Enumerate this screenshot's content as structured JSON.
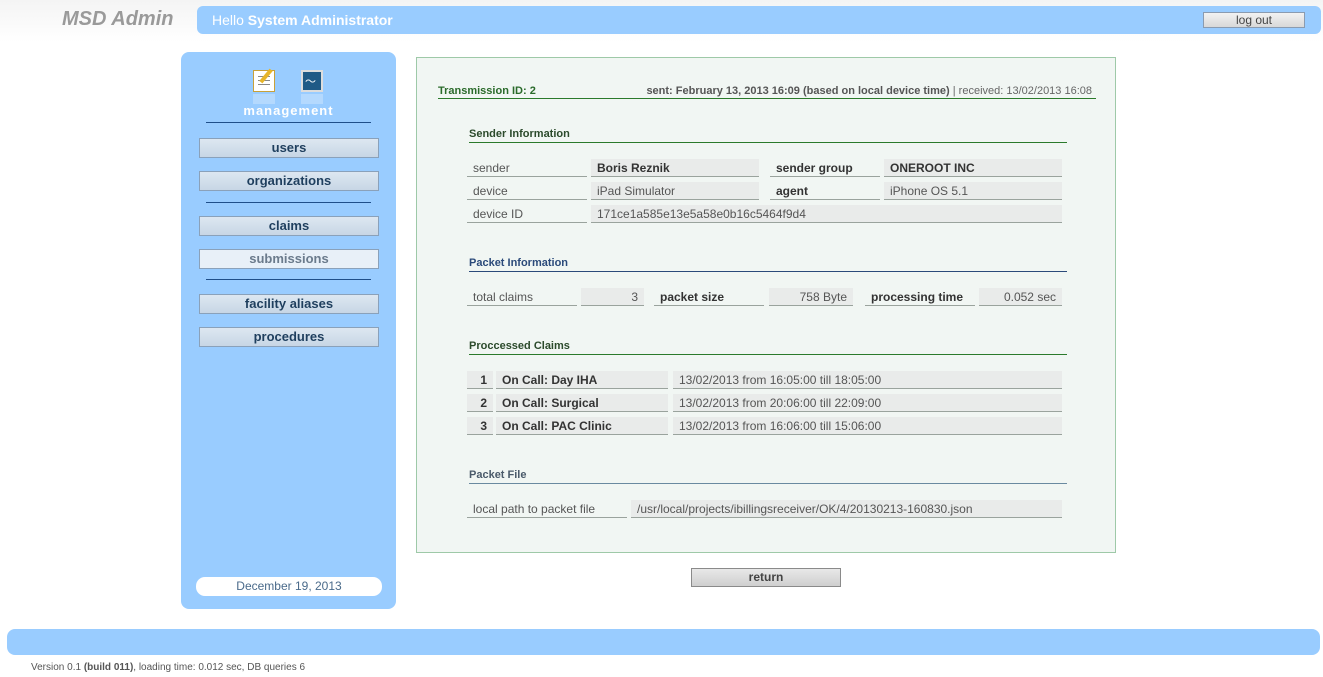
{
  "brand": "MSD Admin",
  "header": {
    "greeting": "Hello",
    "user_name": "System Administrator",
    "logout_label": "log out"
  },
  "sidebar": {
    "icons": [
      "edit-icon",
      "monitor-icon"
    ],
    "section_label": "management",
    "items": [
      {
        "label": "users"
      },
      {
        "label": "organizations"
      },
      {
        "label": "claims"
      },
      {
        "label": "submissions"
      },
      {
        "label": "facility aliases"
      },
      {
        "label": "procedures"
      }
    ],
    "active_item": "submissions",
    "date": "December 19, 2013"
  },
  "transmission": {
    "id_text": "Transmission ID: 2",
    "sent_text": "sent: February 13, 2013 16:09 (based on local device time)",
    "separator": "|",
    "received_text": "received: 13/02/2013 16:08"
  },
  "sender_info": {
    "title": "Sender Information",
    "sender_label": "sender",
    "sender_value": "Boris Reznik",
    "group_label": "sender group",
    "group_value": "ONEROOT INC",
    "device_label": "device",
    "device_value": "iPad Simulator",
    "agent_label": "agent",
    "agent_value": "iPhone OS 5.1",
    "device_id_label": "device ID",
    "device_id_value": "171ce1a585e13e5a58e0b16c5464f9d4"
  },
  "packet_info": {
    "title": "Packet Information",
    "total_claims_label": "total claims",
    "total_claims_value": "3",
    "packet_size_label": "packet size",
    "packet_size_value": "758 Byte",
    "processing_time_label": "processing time",
    "processing_time_value": "0.052 sec"
  },
  "processed_claims": {
    "title": "Proccessed Claims",
    "rows": [
      {
        "num": "1",
        "name": "On Call: Day IHA",
        "period": "13/02/2013 from 16:05:00 till 18:05:00"
      },
      {
        "num": "2",
        "name": "On Call: Surgical",
        "period": "13/02/2013 from 20:06:00 till 22:09:00"
      },
      {
        "num": "3",
        "name": "On Call: PAC Clinic",
        "period": "13/02/2013 from 16:06:00 till 15:06:00"
      }
    ]
  },
  "packet_file": {
    "title": "Packet File",
    "path_label": "local path to packet file",
    "path_value": "/usr/local/projects/ibillingsreceiver/OK/4/20130213-160830.json"
  },
  "return_label": "return",
  "footer": {
    "version_prefix": "Version 0.1",
    "build": "(build 011)",
    "rest": ", loading time: 0.012 sec, DB queries 6"
  },
  "colors": {
    "accent_blue": "#99ccff",
    "section_green": "#2b7a2b",
    "panel_bg": "#f1f6f3"
  }
}
